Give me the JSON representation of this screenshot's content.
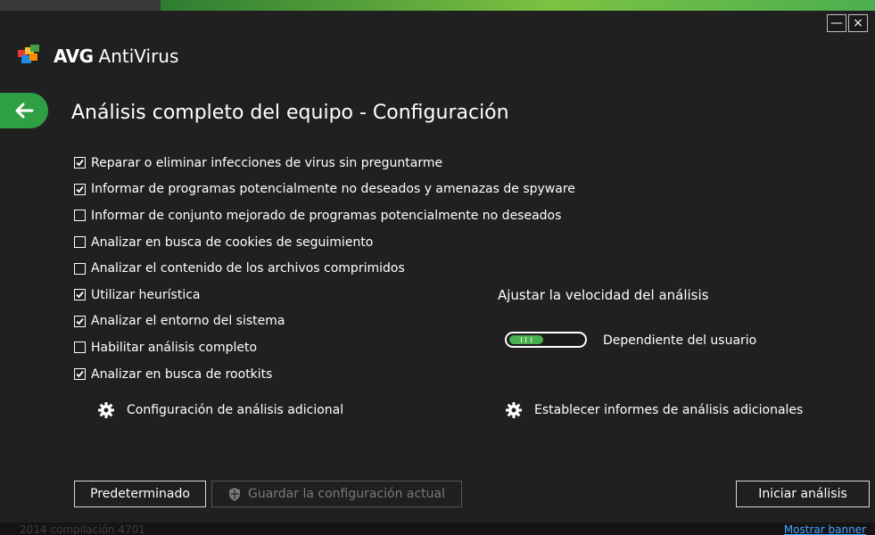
{
  "window": {
    "minimize_label": "—",
    "close_label": "×",
    "brand_name": "AVG",
    "product_name": "AntiVirus"
  },
  "page": {
    "title": "Análisis completo del equipo - Configuración"
  },
  "options": [
    {
      "label": "Reparar o eliminar infecciones de virus sin preguntarme",
      "checked": true
    },
    {
      "label": "Informar de programas potencialmente no deseados y amenazas de spyware",
      "checked": true
    },
    {
      "label": "Informar de conjunto mejorado de programas potencialmente no deseados",
      "checked": false
    },
    {
      "label": "Analizar en busca de cookies de seguimiento",
      "checked": false
    },
    {
      "label": "Analizar el contenido de los archivos comprimidos",
      "checked": false
    },
    {
      "label": "Utilizar heurística",
      "checked": true
    },
    {
      "label": "Analizar el entorno del sistema",
      "checked": true
    },
    {
      "label": "Habilitar análisis completo",
      "checked": false
    },
    {
      "label": "Analizar en busca de rootkits",
      "checked": true
    }
  ],
  "links": {
    "additional_settings": "Configuración de análisis adicional",
    "additional_reports": "Establecer informes de análisis adicionales"
  },
  "speed": {
    "title": "Ajustar la velocidad del análisis",
    "value_label": "Dependiente del usuario",
    "level": 0.45
  },
  "buttons": {
    "default": "Predeterminado",
    "save": "Guardar la configuración actual",
    "start": "Iniciar análisis"
  },
  "footer": {
    "version": "2014  compilación 4701",
    "show_banner": "Mostrar banner"
  },
  "colors": {
    "accent_green": "#2ea043",
    "background": "#202020",
    "link_blue": "#4aa3ff"
  }
}
